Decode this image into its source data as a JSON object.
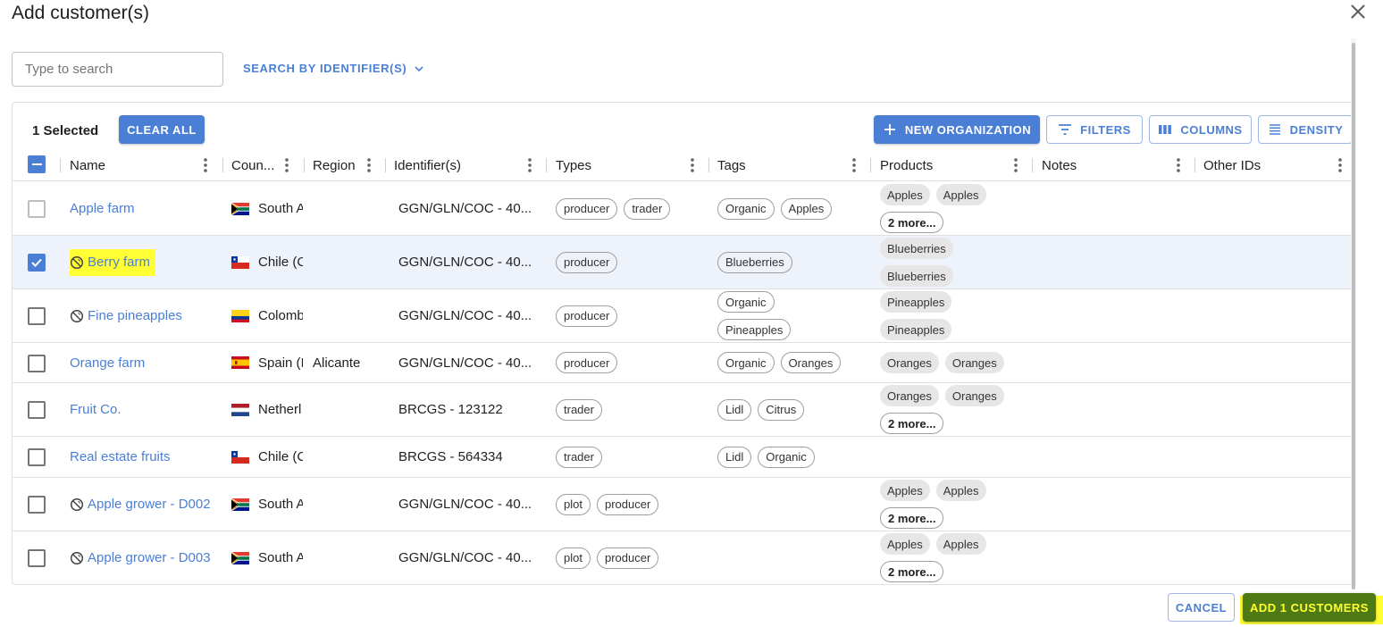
{
  "dialog": {
    "title": "Add customer(s)",
    "close_icon": "close-icon"
  },
  "search": {
    "placeholder": "Type to search",
    "value": "",
    "search_by_label": "SEARCH BY IDENTIFIER(S)"
  },
  "toolbar": {
    "selected_label": "1 Selected",
    "clear_all_label": "CLEAR ALL",
    "new_org_label": "NEW ORGANIZATION",
    "filters_label": "FILTERS",
    "columns_label": "COLUMNS",
    "density_label": "DENSITY"
  },
  "columns": {
    "name": "Name",
    "country": "Coun...",
    "region": "Region",
    "identifiers": "Identifier(s)",
    "types": "Types",
    "tags": "Tags",
    "products": "Products",
    "notes": "Notes",
    "other_ids": "Other IDs"
  },
  "rows": [
    {
      "name": "Apple farm",
      "inactive": false,
      "checked": false,
      "country": "South A",
      "flag": "za",
      "region": "",
      "identifier": "GGN/GLN/COC - 40...",
      "types": [
        "producer",
        "trader"
      ],
      "tags": [
        "Organic",
        "Apples"
      ],
      "products": [
        "Apples",
        "Apples"
      ],
      "more": "2 more..."
    },
    {
      "name": "Berry farm",
      "inactive": true,
      "checked": true,
      "country": "Chile (C",
      "flag": "cl",
      "region": "",
      "identifier": "GGN/GLN/COC - 40...",
      "types": [
        "producer"
      ],
      "tags": [
        "Blueberries"
      ],
      "products": [
        "Blueberries",
        "Blueberries"
      ],
      "more": ""
    },
    {
      "name": "Fine pineapples",
      "inactive": true,
      "checked": false,
      "country": "Colomb",
      "flag": "co",
      "region": "",
      "identifier": "GGN/GLN/COC - 40...",
      "types": [
        "producer"
      ],
      "tags": [
        "Organic",
        "Pineapples"
      ],
      "products": [
        "Pineapples",
        "Pineapples"
      ],
      "more": ""
    },
    {
      "name": "Orange farm",
      "inactive": false,
      "checked": false,
      "country": "Spain (I",
      "flag": "es",
      "region": "Alicante",
      "identifier": "GGN/GLN/COC - 40...",
      "types": [
        "producer"
      ],
      "tags": [
        "Organic",
        "Oranges"
      ],
      "products": [
        "Oranges",
        "Oranges"
      ],
      "more": ""
    },
    {
      "name": "Fruit Co.",
      "inactive": false,
      "checked": false,
      "country": "Netherl",
      "flag": "nl",
      "region": "",
      "identifier": "BRCGS - 123122",
      "types": [
        "trader"
      ],
      "tags": [
        "Lidl",
        "Citrus"
      ],
      "products": [
        "Oranges",
        "Oranges"
      ],
      "more": "2 more..."
    },
    {
      "name": "Real estate fruits",
      "inactive": false,
      "checked": false,
      "country": "Chile (C",
      "flag": "cl",
      "region": "",
      "identifier": "BRCGS - 564334",
      "types": [
        "trader"
      ],
      "tags": [
        "Lidl",
        "Organic"
      ],
      "products": [],
      "more": ""
    },
    {
      "name": "Apple grower - D002",
      "inactive": true,
      "checked": false,
      "country": "South A",
      "flag": "za",
      "region": "",
      "identifier": "GGN/GLN/COC - 40...",
      "types": [
        "plot",
        "producer"
      ],
      "tags": [],
      "products": [
        "Apples",
        "Apples"
      ],
      "more": "2 more..."
    },
    {
      "name": "Apple grower - D003",
      "inactive": true,
      "checked": false,
      "country": "South A",
      "flag": "za",
      "region": "",
      "identifier": "GGN/GLN/COC - 40...",
      "types": [
        "plot",
        "producer"
      ],
      "tags": [],
      "products": [
        "Apples",
        "Apples"
      ],
      "more": "2 more..."
    }
  ],
  "footer": {
    "cancel_label": "CANCEL",
    "add_label": "ADD 1 CUSTOMERS"
  },
  "colors": {
    "accent": "#4b7fd6",
    "add_button_bg": "#4d7a14",
    "highlight": "#ffff33"
  }
}
